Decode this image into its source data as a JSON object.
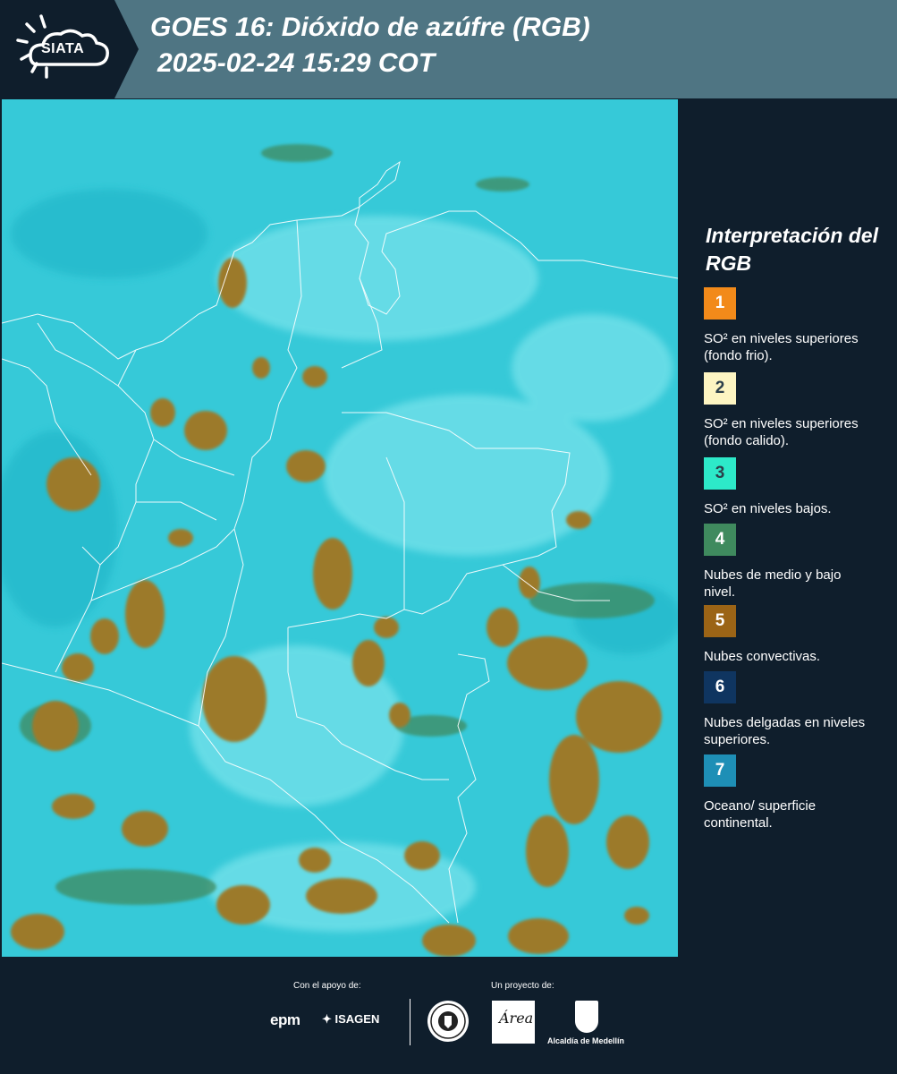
{
  "header": {
    "logo_text": "SIATA",
    "title_line1": "GOES 16: Dióxido de azúfre (RGB)",
    "title_line2": "2025-02-24 15:29 COT"
  },
  "legend": {
    "title": "Interpretación del RGB",
    "items": [
      {
        "number": "1",
        "label": "SO² en niveles superiores (fondo frio).",
        "color": "#f28a1a"
      },
      {
        "number": "2",
        "label": "SO² en niveles superiores (fondo calido).",
        "color": "#fdf5c2"
      },
      {
        "number": "3",
        "label": "SO² en niveles bajos.",
        "color": "#2de9c9"
      },
      {
        "number": "4",
        "label": "Nubes de medio y bajo nivel.",
        "color": "#3f8a5e"
      },
      {
        "number": "5",
        "label": "Nubes convectivas.",
        "color": "#9b6416"
      },
      {
        "number": "6",
        "label": "Nubes delgadas en niveles superiores.",
        "color": "#0f3560"
      },
      {
        "number": "7",
        "label": "Oceano/ superficie continental.",
        "color": "#1e8fb6"
      }
    ]
  },
  "map": {
    "background_color": "#36c9d8",
    "cloud_color": "#9c7a2c",
    "border_color": "#ffffff"
  },
  "footer": {
    "support_label": "Con el apoyo de:",
    "project_label": "Un proyecto de:",
    "sponsor_epm": "epm",
    "sponsor_isagen": "ISAGEN",
    "logo_area_text": "Área",
    "logo_alcaldia": "Alcaldía de Medellín"
  }
}
